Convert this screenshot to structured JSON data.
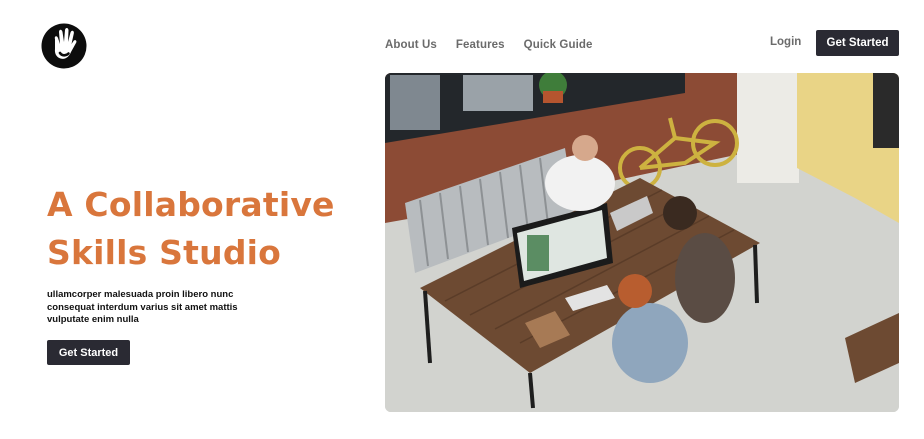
{
  "header": {
    "logo_icon": "hand-in-circle-icon",
    "nav": [
      {
        "label": "About Us"
      },
      {
        "label": "Features"
      },
      {
        "label": "Quick Guide"
      }
    ],
    "login_label": "Login",
    "cta_label": "Get Started"
  },
  "hero": {
    "title_line1": "A Collaborative",
    "title_line2": "Skills Studio",
    "description": "ullamcorper malesuada proin libero nunc consequat interdum varius sit amet mattis vulputate enim nulla",
    "cta_label": "Get Started",
    "image_icon": "team-at-desk-photo"
  },
  "colors": {
    "accent": "#d9763c",
    "button_bg": "#2a2a33",
    "nav_text": "#6b6b6b"
  }
}
